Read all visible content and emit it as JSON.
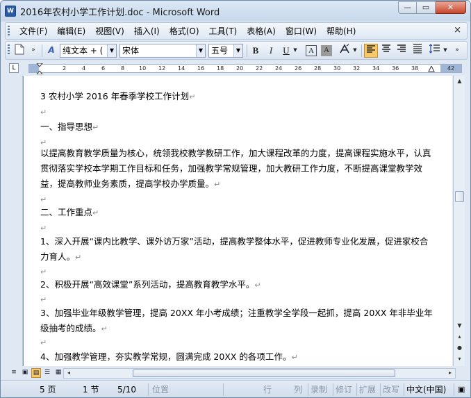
{
  "window": {
    "title": "2016年农村小学工作计划.doc - Microsoft Word",
    "app_icon": "W",
    "minimize_glyph": "—",
    "maximize_glyph": "▭",
    "close_glyph": "✕"
  },
  "menubar": {
    "items": [
      "文件(F)",
      "编辑(E)",
      "视图(V)",
      "插入(I)",
      "格式(O)",
      "工具(T)",
      "表格(A)",
      "窗口(W)",
      "帮助(H)"
    ],
    "close_glyph": "×"
  },
  "toolbar": {
    "style": "纯文本 + (",
    "font": "宋体",
    "size": "五号",
    "bold": "B",
    "italic": "I",
    "underline": "U",
    "char_border": "A",
    "char_shading": "A",
    "icons": [
      "new-document-icon",
      "styles-icon",
      "bold-icon",
      "italic-icon",
      "underline-icon",
      "char-border-icon",
      "char-shading-icon",
      "highlight-icon",
      "align-left-icon",
      "align-center-icon",
      "align-right-icon",
      "justify-icon",
      "line-spacing-icon"
    ]
  },
  "ruler": {
    "corner": "L",
    "numbers": [
      "2",
      "4",
      "6",
      "8",
      "10",
      "12",
      "14",
      "16",
      "18",
      "20",
      "22",
      "24",
      "26",
      "28",
      "30",
      "32",
      "34",
      "36",
      "38",
      "42"
    ]
  },
  "document": {
    "paragraphs": [
      {
        "text": "3 农村小学 2016 年春季学校工作计划"
      },
      {
        "text": ""
      },
      {
        "text": "一、指导思想"
      },
      {
        "text": ""
      },
      {
        "text": "以提高教育教学质量为核心，统领我校教学教研工作，加大课程改革的力度，提高课程实施水平，认真贯彻落实学校本学期工作目标和任务，加强教学常规管理，加大教研工作力度，不断提高课堂教学效益，提高教师业务素质，提高学校办学质量。"
      },
      {
        "text": ""
      },
      {
        "text": "二、工作重点"
      },
      {
        "text": ""
      },
      {
        "text": "1、深入开展“课内比教学、课外访万家”活动，提高教学整体水平，促进教师专业化发展，促进家校合力育人。"
      },
      {
        "text": ""
      },
      {
        "text": "2、积极开展“高效课堂”系列活动，提高教育教学水平。"
      },
      {
        "text": ""
      },
      {
        "text": "3、加强毕业年级教学管理，提高 20XX 年小考成绩；注重教学全学段一起抓，提高 20XX 年非毕业年级抽考的成绩。"
      },
      {
        "text": ""
      },
      {
        "text": "4、加强教学管理，夯实教学常规，圆满完成 20XX 的各项工作。"
      }
    ],
    "para_mark": "↵"
  },
  "statusbar": {
    "page": "5 页",
    "section": "1 节",
    "page_of": "5/10",
    "position": "位置",
    "line": "行",
    "column": "列",
    "rec": "录制",
    "trk": "修订",
    "ext": "扩展",
    "ovr": "改写",
    "language": "中文(中国)"
  },
  "colors": {
    "title_bar": "#c7d8ec",
    "active_button": "#f7c96b",
    "page_bg": "#ffffff",
    "frame_bg": "#9aaec8"
  }
}
